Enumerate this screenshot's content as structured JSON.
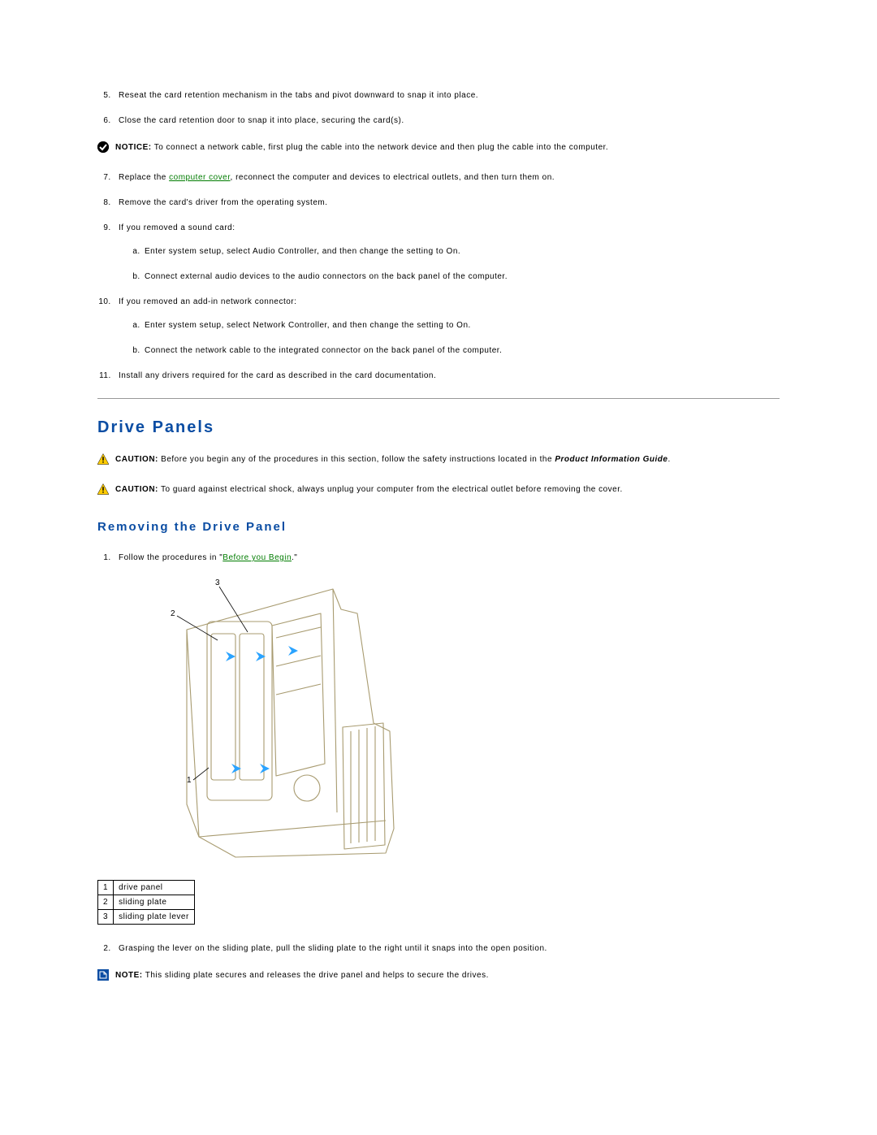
{
  "steps_top": {
    "s5": "Reseat the card retention mechanism in the tabs and pivot downward to snap it into place.",
    "s6": "Close the card retention door to snap it into place, securing the card(s).",
    "notice1_label": "NOTICE:",
    "notice1_text": " To connect a network cable, first plug the cable into the network device and then plug the cable into the computer.",
    "s7_pre": "Replace the ",
    "s7_link": "computer cover",
    "s7_post": ", reconnect the computer and devices to electrical outlets, and then turn them on.",
    "s8": "Remove the card's driver from the operating system.",
    "s9": "If you removed a sound card:",
    "s9a": "Enter system setup, select Audio Controller, and then change the setting to On.",
    "s9b": "Connect external audio devices to the audio connectors on the back panel of the computer.",
    "s10": "If you removed an add-in network connector:",
    "s10a": "Enter system setup, select Network Controller, and then change the setting to On.",
    "s10b": "Connect the network cable to the integrated connector on the back panel of the computer.",
    "s11": "Install any drivers required for the card as described in the card documentation."
  },
  "section": {
    "heading": "Drive Panels",
    "caution1_label": "CAUTION:",
    "caution1_text": " Before you begin any of the procedures in this section, follow the safety instructions located in the ",
    "caution1_italic": "Product Information Guide",
    "caution1_post": ".",
    "caution2_label": "CAUTION:",
    "caution2_text": " To guard against electrical shock, always unplug your computer from the electrical outlet before removing the cover.",
    "subheading": "Removing the Drive Panel",
    "step1_pre": "Follow the procedures in \"",
    "step1_link": "Before you Begin",
    "step1_post": ".\"",
    "step2": "Grasping the lever on the sliding plate, pull the sliding plate to the right until it snaps into the open position.",
    "note_label": "NOTE:",
    "note_text": " This sliding plate secures and releases the drive panel and helps to secure the drives."
  },
  "callouts": {
    "c1": "1",
    "c2": "2",
    "c3": "3"
  },
  "parts": {
    "r1n": "1",
    "r1t": "drive panel",
    "r2n": "2",
    "r2t": "sliding plate",
    "r3n": "3",
    "r3t": "sliding plate lever"
  }
}
